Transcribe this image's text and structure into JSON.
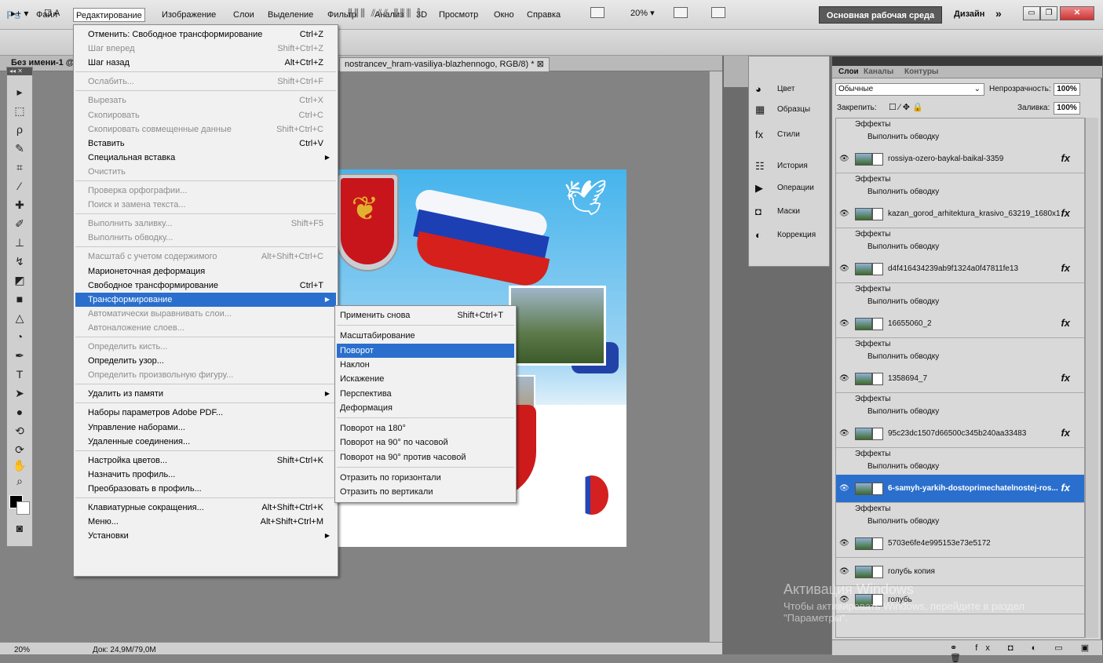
{
  "app": {
    "logo": "Ps"
  },
  "menubar": {
    "items": [
      "Файл",
      "Редактирование",
      "Изображение",
      "Слои",
      "Выделение",
      "Фильтр",
      "Анализ",
      "3D",
      "Просмотр",
      "Окно",
      "Справка"
    ],
    "zoom": "20%",
    "workspace": "Основная рабочая среда",
    "design": "Дизайн",
    "more": "»"
  },
  "options": {
    "autoselect": "А"
  },
  "tabs": {
    "doc1": "Без имени-1 @",
    "doc2": "nostrancev_hram-vasiliya-blazhennogo, RGB/8) *"
  },
  "edit_menu": [
    {
      "label": "Отменить: Свободное трансформирование",
      "shortcut": "Ctrl+Z",
      "state": "en"
    },
    {
      "label": "Шаг вперед",
      "shortcut": "Shift+Ctrl+Z",
      "state": "dis"
    },
    {
      "label": "Шаг назад",
      "shortcut": "Alt+Ctrl+Z",
      "state": "en"
    },
    {
      "sep": true
    },
    {
      "label": "Ослабить...",
      "shortcut": "Shift+Ctrl+F",
      "state": "dis"
    },
    {
      "sep": true
    },
    {
      "label": "Вырезать",
      "shortcut": "Ctrl+X",
      "state": "dis"
    },
    {
      "label": "Скопировать",
      "shortcut": "Ctrl+C",
      "state": "dis"
    },
    {
      "label": "Скопировать совмещенные данные",
      "shortcut": "Shift+Ctrl+C",
      "state": "dis"
    },
    {
      "label": "Вставить",
      "shortcut": "Ctrl+V",
      "state": "en"
    },
    {
      "label": "Специальная вставка",
      "shortcut": "",
      "state": "en",
      "arrow": true
    },
    {
      "label": "Очистить",
      "shortcut": "",
      "state": "dis"
    },
    {
      "sep": true
    },
    {
      "label": "Проверка орфографии...",
      "shortcut": "",
      "state": "dis"
    },
    {
      "label": "Поиск и замена текста...",
      "shortcut": "",
      "state": "dis"
    },
    {
      "sep": true
    },
    {
      "label": "Выполнить заливку...",
      "shortcut": "Shift+F5",
      "state": "dis"
    },
    {
      "label": "Выполнить обводку...",
      "shortcut": "",
      "state": "dis"
    },
    {
      "sep": true
    },
    {
      "label": "Масштаб с учетом содержимого",
      "shortcut": "Alt+Shift+Ctrl+C",
      "state": "dis"
    },
    {
      "label": "Марионеточная деформация",
      "shortcut": "",
      "state": "en"
    },
    {
      "label": "Свободное трансформирование",
      "shortcut": "Ctrl+T",
      "state": "en"
    },
    {
      "label": "Трансформирование",
      "shortcut": "",
      "state": "hl",
      "arrow": true
    },
    {
      "label": "Автоматически выравнивать слои...",
      "shortcut": "",
      "state": "dis"
    },
    {
      "label": "Автоналожение слоев...",
      "shortcut": "",
      "state": "dis"
    },
    {
      "sep": true
    },
    {
      "label": "Определить кисть...",
      "shortcut": "",
      "state": "dis"
    },
    {
      "label": "Определить узор...",
      "shortcut": "",
      "state": "en"
    },
    {
      "label": "Определить произвольную фигуру...",
      "shortcut": "",
      "state": "dis"
    },
    {
      "sep": true
    },
    {
      "label": "Удалить из памяти",
      "shortcut": "",
      "state": "en",
      "arrow": true
    },
    {
      "sep": true
    },
    {
      "label": "Наборы параметров Adobe PDF...",
      "shortcut": "",
      "state": "en"
    },
    {
      "label": "Управление наборами...",
      "shortcut": "",
      "state": "en"
    },
    {
      "label": "Удаленные соединения...",
      "shortcut": "",
      "state": "en"
    },
    {
      "sep": true
    },
    {
      "label": "Настройка цветов...",
      "shortcut": "Shift+Ctrl+K",
      "state": "en"
    },
    {
      "label": "Назначить профиль...",
      "shortcut": "",
      "state": "en"
    },
    {
      "label": "Преобразовать в профиль...",
      "shortcut": "",
      "state": "en"
    },
    {
      "sep": true
    },
    {
      "label": "Клавиатурные сокращения...",
      "shortcut": "Alt+Shift+Ctrl+K",
      "state": "en"
    },
    {
      "label": "Меню...",
      "shortcut": "Alt+Shift+Ctrl+M",
      "state": "en"
    },
    {
      "label": "Установки",
      "shortcut": "",
      "state": "en",
      "arrow": true
    }
  ],
  "transform_submenu": [
    {
      "label": "Применить снова",
      "shortcut": "Shift+Ctrl+T"
    },
    {
      "sep": true
    },
    {
      "label": "Масштабирование",
      "shortcut": ""
    },
    {
      "label": "Поворот",
      "shortcut": "",
      "hl": true
    },
    {
      "label": "Наклон",
      "shortcut": ""
    },
    {
      "label": "Искажение",
      "shortcut": ""
    },
    {
      "label": "Перспектива",
      "shortcut": ""
    },
    {
      "label": "Деформация",
      "shortcut": ""
    },
    {
      "sep": true
    },
    {
      "label": "Поворот на 180°",
      "shortcut": ""
    },
    {
      "label": "Поворот на 90° по часовой",
      "shortcut": ""
    },
    {
      "label": "Поворот на 90° против часовой",
      "shortcut": ""
    },
    {
      "sep": true
    },
    {
      "label": "Отразить по горизонтали",
      "shortcut": ""
    },
    {
      "label": "Отразить по вертикали",
      "shortcut": ""
    }
  ],
  "mid_panel": [
    "Цвет",
    "Образцы",
    "Стили",
    "История",
    "Операции",
    "Маски",
    "Коррекция"
  ],
  "layers_panel": {
    "tabs": [
      "Слои",
      "Каналы",
      "Контуры"
    ],
    "blend_mode": "Обычные",
    "opacity_label": "Непрозрачность:",
    "opacity": "100%",
    "lock_label": "Закрепить:",
    "fill_label": "Заливка:",
    "fill": "100%",
    "effects_label": "Эффекты",
    "stroke_label": "Выполнить обводку",
    "layers": [
      {
        "name": "rossiya-ozero-baykal-baikal-3359",
        "fx": "fx"
      },
      {
        "name": "kazan_gorod_arhitektura_krasivo_63219_1680x10...",
        "fx": "fx"
      },
      {
        "name": "d4f416434239ab9f1324a0f47811fe13",
        "fx": "fx"
      },
      {
        "name": "16655060_2",
        "fx": "fx"
      },
      {
        "name": "1358694_7",
        "fx": "fx"
      },
      {
        "name": "95c23dc1507d66500c345b240aa33483",
        "fx": "fx"
      },
      {
        "name": "6-samyh-yarkih-dostoprimechatelnostej-ros...",
        "fx": "fx",
        "selected": true
      },
      {
        "name": "5703e6fe4e995153e73e5172",
        "fx": ""
      },
      {
        "name": "голубь копия",
        "fx": ""
      },
      {
        "name": "голубь",
        "fx": ""
      }
    ]
  },
  "status": {
    "zoom": "20%",
    "doc": "Док: 24,9M/79,0M"
  },
  "watermark": {
    "title": "Активация Windows",
    "text": "Чтобы активировать Windows, перейдите в раздел \"Параметры\"."
  }
}
